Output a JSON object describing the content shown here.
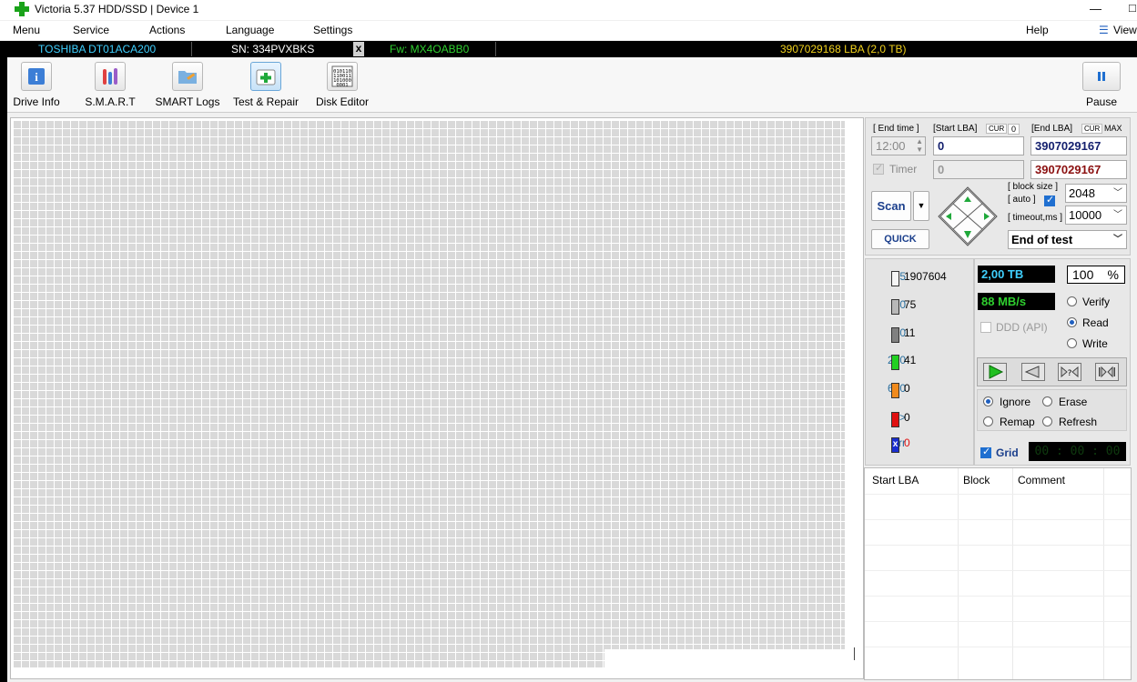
{
  "window": {
    "title": "Victoria 5.37 HDD/SSD | Device 1",
    "minimize": "—",
    "maximize": "□"
  },
  "menu": {
    "items": [
      "Menu",
      "Service",
      "Actions",
      "Language",
      "Settings"
    ],
    "help": "Help",
    "view": "View"
  },
  "drive": {
    "model": "TOSHIBA DT01ACA200",
    "serial": "SN: 334PVXBKS",
    "close": "x",
    "firmware": "Fw: MX4OABB0",
    "capacity": "3907029168 LBA (2,0 TB)"
  },
  "toolbar": {
    "buttons": [
      "Drive Info",
      "S.M.A.R.T",
      "SMART Logs",
      "Test & Repair",
      "Disk Editor"
    ],
    "active": "Test & Repair",
    "pause": "Pause"
  },
  "scan": {
    "end_time_label": "[ End time ]",
    "start_lba_label": "[Start LBA]",
    "cur_label": "CUR",
    "cur_value": "0",
    "end_lba_label": "[End LBA]",
    "max_label": "MAX",
    "end_time": "12:00",
    "start_lba": "0",
    "end_lba": "3907029167",
    "timer_label": "Timer",
    "timer_value": "0",
    "end_lba_2": "3907029167",
    "block_size_label": "[ block size ]",
    "auto_label": "[ auto ]",
    "block_size": "2048",
    "timeout_label": "[ timeout,ms ]",
    "timeout": "10000",
    "scan_button": "Scan",
    "quick_button": "QUICK",
    "end_action": "End of test"
  },
  "legend": [
    {
      "threshold": "5",
      "count": "1907604",
      "color": "#f5f5f5"
    },
    {
      "threshold": "20",
      "count": "75",
      "color": "#b8b8b8"
    },
    {
      "threshold": "50",
      "count": "11",
      "color": "#808080"
    },
    {
      "threshold": "200",
      "count": "41",
      "color": "#22d022"
    },
    {
      "threshold": "600",
      "count": "0",
      "color": "#f08a1c"
    },
    {
      "threshold": ">",
      "count": "0",
      "color": "#e01010"
    },
    {
      "threshold": "Err",
      "count": "0",
      "color": "#1a2fd0"
    }
  ],
  "status": {
    "size": "2,00 TB",
    "percent": "100",
    "percent_sign": "%",
    "speed": "88 MB/s",
    "ddd_label": "DDD (API)",
    "modes": [
      "Verify",
      "Read",
      "Write"
    ],
    "selected_mode": "Read"
  },
  "actions": {
    "options": [
      "Ignore",
      "Erase",
      "Remap",
      "Refresh"
    ],
    "selected": "Ignore",
    "grid_label": "Grid",
    "timer_display": "00 : 00 : 00"
  },
  "log_table": {
    "columns": [
      "Start LBA",
      "Block",
      "Comment"
    ]
  }
}
